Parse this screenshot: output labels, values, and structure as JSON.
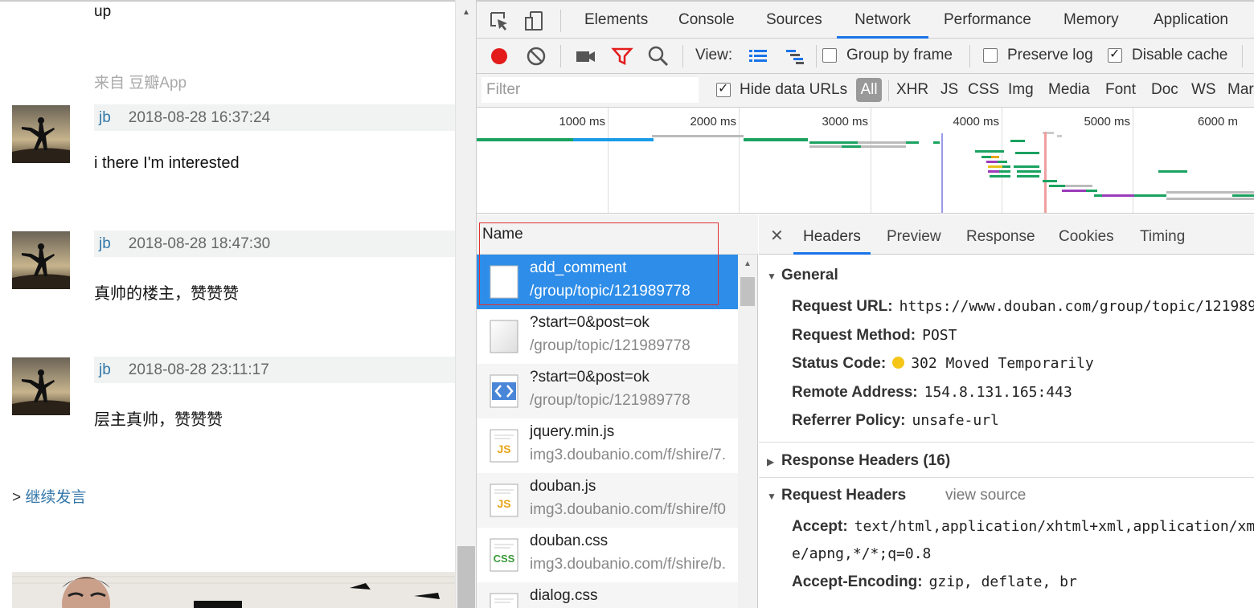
{
  "page": {
    "top_text": "up",
    "from_text": "来自 豆瓣App",
    "comments": [
      {
        "user": "jb",
        "time": "2018-08-28 16:37:24",
        "text": "i there I'm interested"
      },
      {
        "user": "jb",
        "time": "2018-08-28 18:47:30",
        "text": "真帅的楼主，赞赞赞"
      },
      {
        "user": "jb",
        "time": "2018-08-28 23:11:17",
        "text": "层主真帅，赞赞赞"
      }
    ],
    "continue_prefix": ">",
    "continue_link": "继续发言"
  },
  "devtools": {
    "tabs": [
      "Elements",
      "Console",
      "Sources",
      "Network",
      "Performance",
      "Memory",
      "Application"
    ],
    "active_tab": "Network",
    "toolbar": {
      "view_label": "View:",
      "group_by_frame": "Group by frame",
      "preserve_log": "Preserve log",
      "disable_cache": "Disable cache",
      "group_by_frame_checked": false,
      "preserve_log_checked": false,
      "disable_cache_checked": true
    },
    "filterbar": {
      "placeholder": "Filter",
      "hide_data_urls": "Hide data URLs",
      "all": "All",
      "types": [
        "XHR",
        "JS",
        "CSS",
        "Img",
        "Media",
        "Font",
        "Doc",
        "WS",
        "Mar"
      ]
    },
    "overview": {
      "ticks": [
        "1000 ms",
        "2000 ms",
        "3000 ms",
        "4000 ms",
        "5000 ms",
        "6000 m"
      ]
    },
    "requests": {
      "column_name": "Name",
      "rows": [
        {
          "name": "add_comment",
          "path": "/group/topic/121989778",
          "icon": "document-icon",
          "selected": true
        },
        {
          "name": "?start=0&post=ok",
          "path": "/group/topic/121989778",
          "icon": "document-icon",
          "selected": false
        },
        {
          "name": "?start=0&post=ok",
          "path": "/group/topic/121989778",
          "icon": "html-icon",
          "selected": false
        },
        {
          "name": "jquery.min.js",
          "path": "img3.doubanio.com/f/shire/7.",
          "icon": "js-icon",
          "selected": false
        },
        {
          "name": "douban.js",
          "path": "img3.doubanio.com/f/shire/f0",
          "icon": "js-icon",
          "selected": false
        },
        {
          "name": "douban.css",
          "path": "img3.doubanio.com/f/shire/b.",
          "icon": "css-icon",
          "selected": false
        },
        {
          "name": "dialog.css",
          "path": "",
          "icon": "css-icon",
          "selected": false
        }
      ]
    },
    "details": {
      "tabs": [
        "Headers",
        "Preview",
        "Response",
        "Cookies",
        "Timing"
      ],
      "active_tab": "Headers",
      "general_title": "General",
      "general": {
        "request_url_k": "Request URL:",
        "request_url_v": "https://www.douban.com/group/topic/121989",
        "request_method_k": "Request Method:",
        "request_method_v": "POST",
        "status_code_k": "Status Code:",
        "status_code_v": "302 Moved Temporarily",
        "remote_address_k": "Remote Address:",
        "remote_address_v": "154.8.131.165:443",
        "referrer_policy_k": "Referrer Policy:",
        "referrer_policy_v": "unsafe-url"
      },
      "response_headers_title": "Response Headers (16)",
      "request_headers_title": "Request Headers",
      "view_source": "view source",
      "request_headers": {
        "accept_k": "Accept:",
        "accept_v": "text/html,application/xhtml+xml,application/xm",
        "accept_cont": "e/apng,*/*;q=0.8",
        "accept_encoding_k": "Accept-Encoding:",
        "accept_encoding_v": "gzip, deflate, br"
      }
    },
    "colors": {
      "accent": "#1a73e8",
      "selected_row": "#2e8de8",
      "record": "#e31b1b",
      "status_dot": "#f5c518"
    }
  }
}
